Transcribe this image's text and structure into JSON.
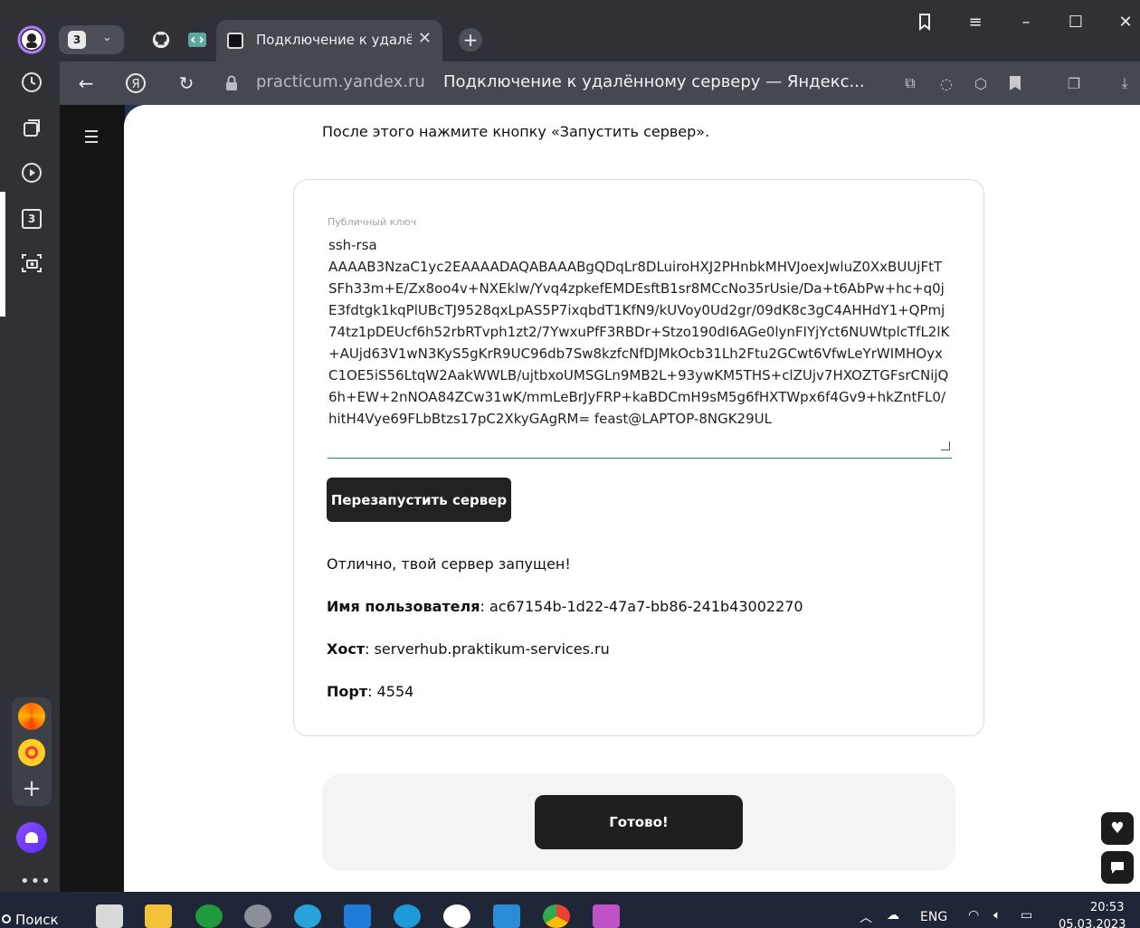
{
  "browser": {
    "tab_count": "3",
    "active_tab_title": "Подключение к удалён",
    "url_domain": "practicum.yandex.ru",
    "page_title": "Подключение к удалённому серверу — Яндекс..."
  },
  "sidebar": {
    "badge": "3"
  },
  "page": {
    "intro": "После этого нажмите кнопку «Запустить сервер».",
    "key_label": "Публичный ключ",
    "key_value": "ssh-rsa\nAAAAB3NzaC1yc2EAAAADAQABAAABgQDqLr8DLuiroHXJ2PHnbkMHVJoexJwluZ0XxBUUjFtTSFh33m+E/Zx8oo4v+NXEklw/Yvq4zpkefEMDEsftB1sr8MCcNo35rUsie/Da+t6AbPw+hc+q0jE3fdtgk1kqPlUBcTJ9528qxLpAS5P7ixqbdT1KfN9/kUVoy0Ud2gr/09dK8c3gC4AHHdY1+QPmj74tz1pDEUcf6h52rbRTvph1zt2/7YwxuPfF3RBDr+Stzo190dI6AGe0lynFIYjYct6NUWtplcTfL2lK+AUjd63V1wN3KyS5gKrR9UC96db7Sw8kzfcNfDJMkOcb31Lh2Ftu2GCwt6VfwLeYrWIMHOyxC1OE5iS56LtqW2AakWWLB/ujtbxoUMSGLn9MB2L+93ywKM5THS+clZUjv7HXOZTGFsrCNijQ6h+EW+2nNOA84ZCw31wK/mmLeBrJyFRP+kaBDCmH9sM5g6fHXTWpx6f4Gv9+hkZntFL0/hitH4Vye69FLbBtzs17pC2XkyGAgRM= feast@LAPTOP-8NGK29UL",
    "restart_button": "Перезапустить сервер",
    "success_message": "Отлично, твой сервер запущен!",
    "username_label": "Имя пользователя",
    "username_value": ": ac67154b-1d22-47a7-bb86-241b43002270",
    "host_label": "Хост",
    "host_value": ": serverhub.praktikum-services.ru",
    "port_label": "Порт",
    "port_value": ": 4554",
    "done_button": "Готово!"
  },
  "taskbar": {
    "search_label": "Поиск",
    "language": "ENG",
    "time": "20:53",
    "date": "05.03.2023"
  }
}
